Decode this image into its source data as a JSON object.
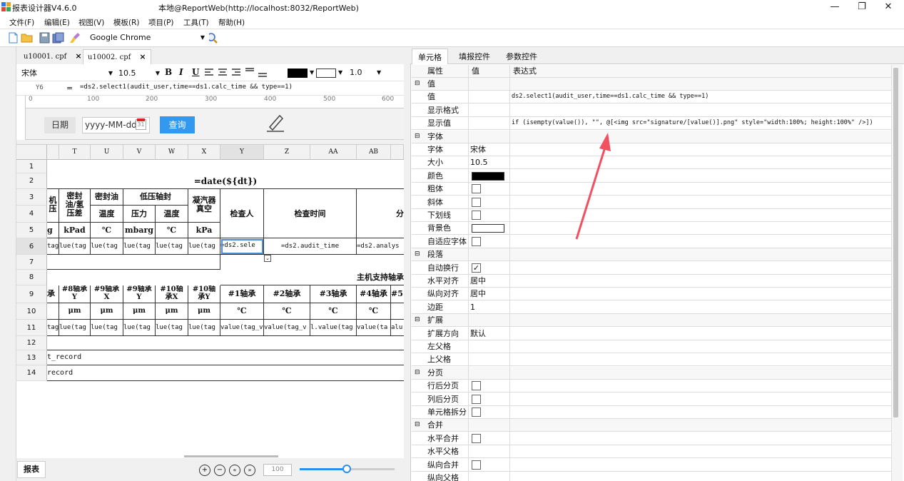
{
  "titlebar": {
    "app": "报表设计器V4.6.0",
    "title": "本地@ReportWeb(http://localhost:8032/ReportWeb)",
    "minimize": "—",
    "maximize": "❐",
    "close": "✕"
  },
  "menu": [
    "文件(F)",
    "编辑(E)",
    "视图(V)",
    "模板(R)",
    "项目(P)",
    "工具(T)",
    "帮助(H)"
  ],
  "toolbar": {
    "browser": "Google Chrome",
    "icons": [
      "new-file-icon",
      "open-folder-icon",
      "save-icon",
      "save-all-icon",
      "clear-icon",
      "search-icon"
    ]
  },
  "doc_tabs": [
    {
      "label": "u10001. cpf",
      "close": "×"
    },
    {
      "label": "u10002. cpf",
      "close": "×"
    }
  ],
  "format": {
    "font": "宋体",
    "size": "10.5",
    "line_width": "1.0",
    "bold": "B",
    "italic": "I",
    "underline": "U"
  },
  "formula": {
    "cell_ref": "Y6",
    "eq": "=",
    "text": "=ds2.select1(audit_user,time==ds1.calc_time && type==1)"
  },
  "ruler": [
    "0",
    "100",
    "200",
    "300",
    "400",
    "500",
    "600"
  ],
  "query": {
    "date_label": "日期",
    "date_placeholder": "yyyy-MM-dd",
    "cal_day": "31",
    "query_button": "查询"
  },
  "grid": {
    "columns": [
      "T",
      "U",
      "V",
      "W",
      "X",
      "Y",
      "Z",
      "AA",
      "AB"
    ],
    "rows": [
      "1",
      "2",
      "3",
      "4",
      "5",
      "6",
      "7",
      "8",
      "9",
      "10",
      "11",
      "12",
      "13",
      "14"
    ],
    "title_formula": "=date(${dt})",
    "r3": {
      "a": "机\n压",
      "t": "密封\n油/氢\n压差",
      "u": "密封油",
      "vw": "低压轴封",
      "x": "凝汽器\n真空",
      "y": "检查人",
      "zaa": "检查时间",
      "ab": "分"
    },
    "r4": {
      "u": "温度",
      "v": "压力",
      "w": "温度"
    },
    "r5": {
      "a": "g",
      "t": "kPad",
      "u": "℃",
      "v": "mbarg",
      "w": "℃",
      "x": "kPa"
    },
    "r6": {
      "a": "tag",
      "t": "lue(tag",
      "u": "lue(tag",
      "v": "lue(tag",
      "w": "lue(tag",
      "x": "lue(tag",
      "y": "=ds2.sele",
      "z": "=ds2.audit_time",
      "ab": "=ds2.analys"
    },
    "r8": "主机支持轴承",
    "r9": {
      "a": "承",
      "t": "#8轴承\nY",
      "u": "#9轴承\nX",
      "v": "#9轴承\nY",
      "w": "#10轴\n承X",
      "x": "#10轴\n承Y",
      "y": "#1轴承",
      "z": "#2轴承",
      "aa": "#3轴承",
      "ab": "#4轴承",
      "ac": "#5"
    },
    "r10": {
      "t": "μm",
      "u": "μm",
      "v": "μm",
      "w": "μm",
      "x": "μm",
      "y": "℃",
      "z": "℃",
      "aa": "℃",
      "ab": "℃"
    },
    "r11": {
      "a": "tag",
      "t": "lue(tag",
      "u": "lue(tag",
      "v": "lue(tag",
      "w": "lue(tag",
      "x": "lue(tag",
      "y": "value(tag_v",
      "z": "value(tag_v",
      "aa": "l.value(tag",
      "ab": "value(ta",
      "ac": "alu"
    },
    "r13": "t_record",
    "r14": "record"
  },
  "sheet_tab": "报表",
  "zoom": "100",
  "right_tabs": [
    "单元格",
    "填报控件",
    "参数控件"
  ],
  "props": {
    "headers": [
      "属性",
      "值",
      "表达式"
    ],
    "rows": [
      {
        "type": "group",
        "name": "值"
      },
      {
        "type": "item",
        "name": "值",
        "expr": "ds2.select1(audit_user,time==ds1.calc_time && type==1)"
      },
      {
        "type": "item",
        "name": "显示格式"
      },
      {
        "type": "item",
        "name": "显示值",
        "expr": "if (isempty(value()), \"\", @[<img src=\"signature/[value()].png\" style=\"width:100%; height:100%\" />])"
      },
      {
        "type": "group",
        "name": "字体"
      },
      {
        "type": "item",
        "name": "字体",
        "value": "宋体"
      },
      {
        "type": "item",
        "name": "大小",
        "value": "10.5"
      },
      {
        "type": "color",
        "name": "颜色",
        "color": "#000000"
      },
      {
        "type": "check",
        "name": "粗体",
        "checked": false
      },
      {
        "type": "check",
        "name": "斜体",
        "checked": false
      },
      {
        "type": "check",
        "name": "下划线",
        "checked": false
      },
      {
        "type": "color",
        "name": "背景色",
        "color": "#ffffff"
      },
      {
        "type": "check",
        "name": "自适应字体",
        "checked": false
      },
      {
        "type": "group",
        "name": "段落"
      },
      {
        "type": "check",
        "name": "自动换行",
        "checked": true
      },
      {
        "type": "item",
        "name": "水平对齐",
        "value": "居中"
      },
      {
        "type": "item",
        "name": "纵向对齐",
        "value": "居中"
      },
      {
        "type": "item",
        "name": "边距",
        "value": "1"
      },
      {
        "type": "group",
        "name": "扩展"
      },
      {
        "type": "item",
        "name": "扩展方向",
        "value": "默认"
      },
      {
        "type": "item",
        "name": "左父格"
      },
      {
        "type": "item",
        "name": "上父格"
      },
      {
        "type": "group",
        "name": "分页"
      },
      {
        "type": "check",
        "name": "行后分页",
        "checked": false
      },
      {
        "type": "check",
        "name": "列后分页",
        "checked": false
      },
      {
        "type": "check",
        "name": "单元格拆分",
        "checked": false
      },
      {
        "type": "group",
        "name": "合并"
      },
      {
        "type": "check",
        "name": "水平合并",
        "checked": false
      },
      {
        "type": "item",
        "name": "水平父格"
      },
      {
        "type": "check",
        "name": "纵向合并",
        "checked": false
      },
      {
        "type": "item",
        "name": "纵向父格"
      }
    ]
  },
  "colors": {
    "accent": "#3399ee",
    "arrow": "#f05060",
    "slider": "#2b8fe8"
  }
}
